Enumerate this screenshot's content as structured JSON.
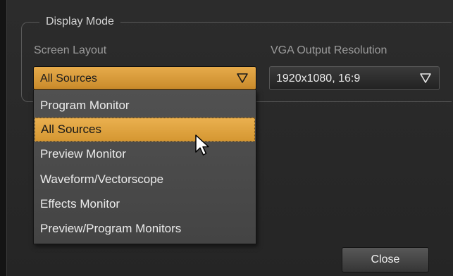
{
  "group": {
    "title": "Display Mode"
  },
  "screen_layout": {
    "label": "Screen Layout",
    "value": "All Sources",
    "arrow_icon": "triangle-down-outline-icon",
    "options": [
      "Program Monitor",
      "All Sources",
      "Preview Monitor",
      "Waveform/Vectorscope",
      "Effects Monitor",
      "Preview/Program Monitors"
    ],
    "highlighted_index": 1
  },
  "vga_output": {
    "label": "VGA Output Resolution",
    "value": "1920x1080, 16:9",
    "arrow_icon": "triangle-down-outline-icon"
  },
  "buttons": {
    "close_label": "Close"
  },
  "cursor_icon": "mouse-pointer-icon",
  "colors": {
    "accent": "#e0a23f",
    "background": "#2b2b2b",
    "dropdown": "#4a4a4a"
  }
}
